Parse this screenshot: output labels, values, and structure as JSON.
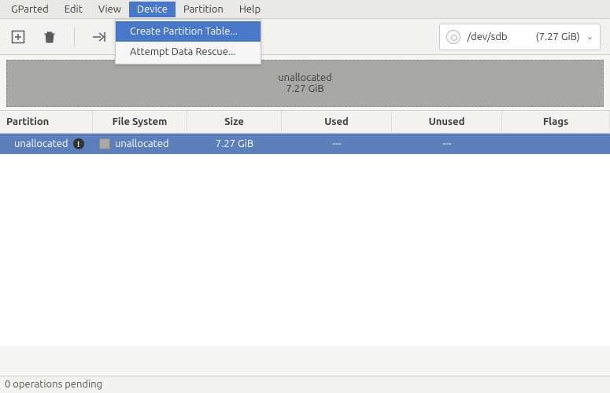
{
  "menubar": {
    "items": [
      "GParted",
      "Edit",
      "View",
      "Device",
      "Partition",
      "Help"
    ],
    "open_index": 3
  },
  "device_menu": {
    "items": [
      {
        "label": "Create Partition Table...",
        "selected": true
      },
      {
        "label": "Attempt Data Rescue...",
        "selected": false
      }
    ]
  },
  "toolbar": {
    "new_partition": "new-partition",
    "delete": "delete",
    "apply": "apply"
  },
  "device_selector": {
    "path": "/dev/sdb",
    "size": "(7.27 GiB)"
  },
  "diskmap": {
    "label": "unallocated",
    "size": "7.27 GiB"
  },
  "table": {
    "headers": [
      "Partition",
      "File System",
      "Size",
      "Used",
      "Unused",
      "Flags"
    ],
    "rows": [
      {
        "partition": "unallocated",
        "warn": true,
        "fs_label": "unallocated",
        "size": "7.27 GiB",
        "used": "---",
        "unused": "---",
        "flags": ""
      }
    ]
  },
  "statusbar": {
    "text": "0 operations pending"
  }
}
